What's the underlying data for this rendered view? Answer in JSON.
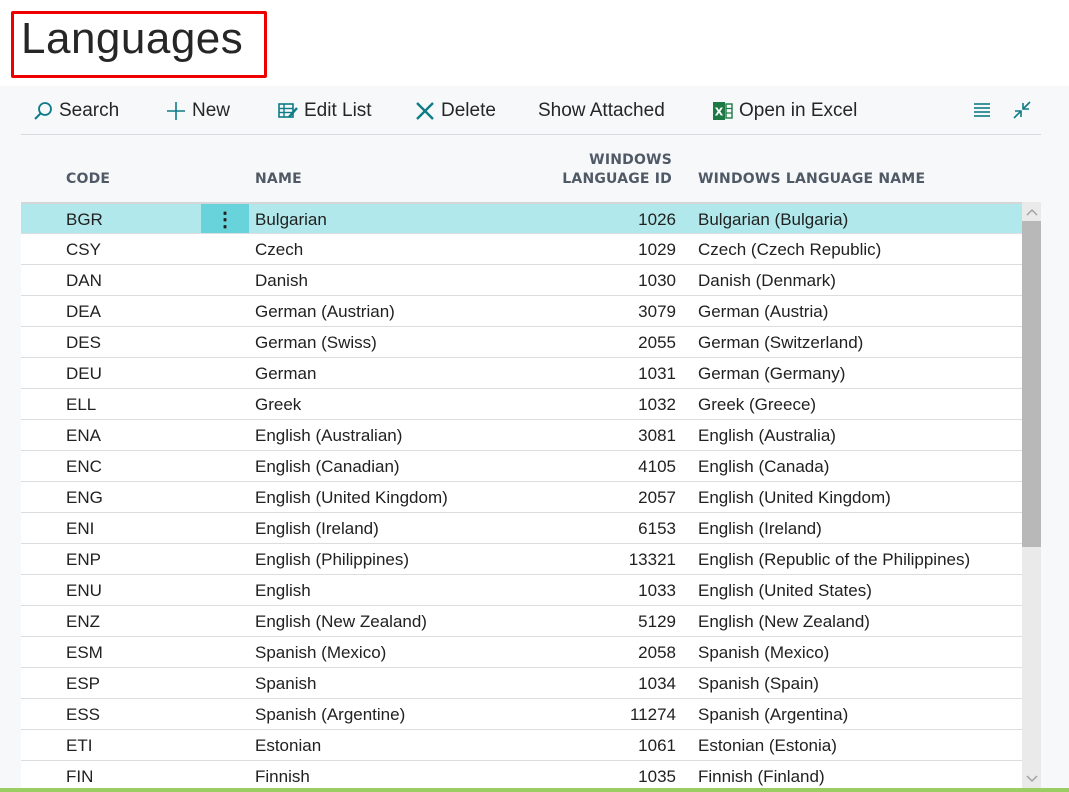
{
  "page": {
    "title": "Languages"
  },
  "toolbar": {
    "search_label": "Search",
    "new_label": "New",
    "edit_list_label": "Edit List",
    "delete_label": "Delete",
    "show_attached_label": "Show Attached",
    "open_in_excel_label": "Open in Excel",
    "icons": [
      "search-icon",
      "plus-icon",
      "edit-list-icon",
      "delete-x-icon",
      "excel-icon",
      "list-view-icon",
      "collapse-icon"
    ],
    "accent_color": "#0e7c86"
  },
  "table": {
    "headers": {
      "code": "CODE",
      "name": "NAME",
      "windows_language_id_line1": "WINDOWS",
      "windows_language_id_line2": "LANGUAGE ID",
      "windows_language_name": "WINDOWS LANGUAGE NAME"
    },
    "selected_row_color": "#b1e8eb",
    "row_menu_glyph": "⋮",
    "rows": [
      {
        "code": "BGR",
        "name": "Bulgarian",
        "id": "1026",
        "wname": "Bulgarian (Bulgaria)"
      },
      {
        "code": "CSY",
        "name": "Czech",
        "id": "1029",
        "wname": "Czech (Czech Republic)"
      },
      {
        "code": "DAN",
        "name": "Danish",
        "id": "1030",
        "wname": "Danish (Denmark)"
      },
      {
        "code": "DEA",
        "name": "German (Austrian)",
        "id": "3079",
        "wname": "German (Austria)"
      },
      {
        "code": "DES",
        "name": "German (Swiss)",
        "id": "2055",
        "wname": "German (Switzerland)"
      },
      {
        "code": "DEU",
        "name": "German",
        "id": "1031",
        "wname": "German (Germany)"
      },
      {
        "code": "ELL",
        "name": "Greek",
        "id": "1032",
        "wname": "Greek (Greece)"
      },
      {
        "code": "ENA",
        "name": "English (Australian)",
        "id": "3081",
        "wname": "English (Australia)"
      },
      {
        "code": "ENC",
        "name": "English (Canadian)",
        "id": "4105",
        "wname": "English (Canada)"
      },
      {
        "code": "ENG",
        "name": "English (United Kingdom)",
        "id": "2057",
        "wname": "English (United Kingdom)"
      },
      {
        "code": "ENI",
        "name": "English (Ireland)",
        "id": "6153",
        "wname": "English (Ireland)"
      },
      {
        "code": "ENP",
        "name": "English (Philippines)",
        "id": "13321",
        "wname": "English (Republic of the Philippines)"
      },
      {
        "code": "ENU",
        "name": "English",
        "id": "1033",
        "wname": "English (United States)"
      },
      {
        "code": "ENZ",
        "name": "English (New Zealand)",
        "id": "5129",
        "wname": "English (New Zealand)"
      },
      {
        "code": "ESM",
        "name": "Spanish (Mexico)",
        "id": "2058",
        "wname": "Spanish (Mexico)"
      },
      {
        "code": "ESP",
        "name": "Spanish",
        "id": "1034",
        "wname": "Spanish (Spain)"
      },
      {
        "code": "ESS",
        "name": "Spanish (Argentine)",
        "id": "11274",
        "wname": "Spanish (Argentina)"
      },
      {
        "code": "ETI",
        "name": "Estonian",
        "id": "1061",
        "wname": "Estonian (Estonia)"
      },
      {
        "code": "FIN",
        "name": "Finnish",
        "id": "1035",
        "wname": "Finnish (Finland)"
      }
    ]
  }
}
